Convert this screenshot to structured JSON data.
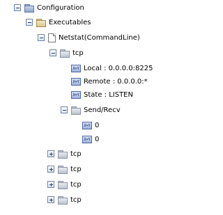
{
  "tree": {
    "root": {
      "label": "Configuration",
      "state": "expanded",
      "icon": "folder-blue-icon"
    },
    "executables": {
      "label": "Executables",
      "state": "expanded",
      "icon": "folder-tan-icon"
    },
    "netstat": {
      "label": "Netstat(CommandLine)",
      "state": "expanded",
      "icon": "document-icon"
    },
    "tcp_open": {
      "label": "tcp",
      "state": "expanded",
      "attributes": [
        {
          "label": "Local : 0.0.0.0:8225",
          "icon_text": "X=Y"
        },
        {
          "label": "Remote : 0.0.0.0:*",
          "icon_text": "X=Y"
        },
        {
          "label": "State : LISTEN",
          "icon_text": "X=Y"
        }
      ],
      "send_recv": {
        "label": "Send/Recv",
        "state": "expanded",
        "values": [
          {
            "label": "0",
            "icon_text": "X=Y"
          },
          {
            "label": "0",
            "icon_text": "X=Y"
          }
        ]
      }
    },
    "tcp_collapsed": [
      {
        "label": "tcp",
        "state": "collapsed"
      },
      {
        "label": "tcp",
        "state": "collapsed"
      },
      {
        "label": "tcp",
        "state": "collapsed"
      },
      {
        "label": "tcp",
        "state": "collapsed"
      }
    ]
  }
}
